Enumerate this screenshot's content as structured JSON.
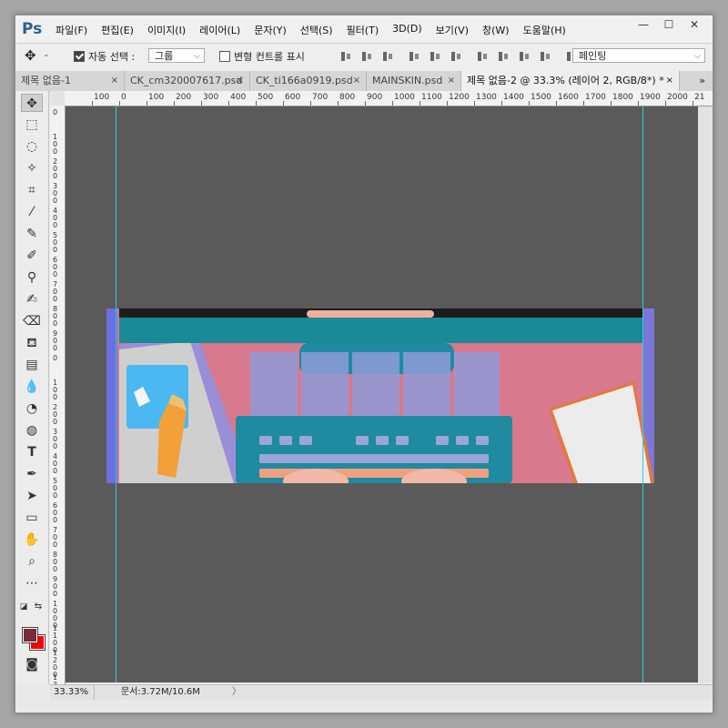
{
  "app": {
    "logo": "Ps"
  },
  "menu": [
    "파일(F)",
    "편집(E)",
    "이미지(I)",
    "레이어(L)",
    "문자(Y)",
    "선택(S)",
    "필터(T)",
    "3D(D)",
    "보기(V)",
    "창(W)",
    "도움말(H)"
  ],
  "window_controls": {
    "minimize": "—",
    "maximize": "☐",
    "close": "✕"
  },
  "options": {
    "auto_select_label": "자동 선택 :",
    "auto_select_value": "그룹",
    "transform_controls_label": "변형 컨트롤 표시",
    "mode_3d_value": "페인팅"
  },
  "tabs": [
    {
      "label": "제목 없음-1",
      "close": "×"
    },
    {
      "label": "CK_cm320007617.psd",
      "close": "×"
    },
    {
      "label": "CK_ti166a0919.psd",
      "close": "×"
    },
    {
      "label": "MAINSKIN.psd",
      "close": "×"
    },
    {
      "label": "제목 없음-2 @ 33.3% (레이어 2, RGB/8*) *",
      "close": "×"
    }
  ],
  "tab_overflow": "»",
  "ruler_h": [
    "100",
    "0",
    "100",
    "200",
    "300",
    "400",
    "500",
    "600",
    "700",
    "800",
    "900",
    "1000",
    "1100",
    "1200",
    "1300",
    "1400",
    "1500",
    "1600",
    "1700",
    "1800",
    "1900",
    "2000",
    "21"
  ],
  "ruler_v": [
    "0",
    "100",
    "200",
    "300",
    "400",
    "500",
    "600",
    "700",
    "800",
    "900",
    "0",
    "100",
    "200",
    "300",
    "400",
    "500",
    "600",
    "700",
    "800",
    "900",
    "1000",
    "1100",
    "1200",
    "1300"
  ],
  "status": {
    "zoom": "33.33%",
    "doc_size": "문서:3.72M/10.6M",
    "arrow": "〉"
  },
  "colors": {
    "foreground": "#7a2a3c",
    "background": "#ff0000",
    "guide": "#35c9e0"
  }
}
